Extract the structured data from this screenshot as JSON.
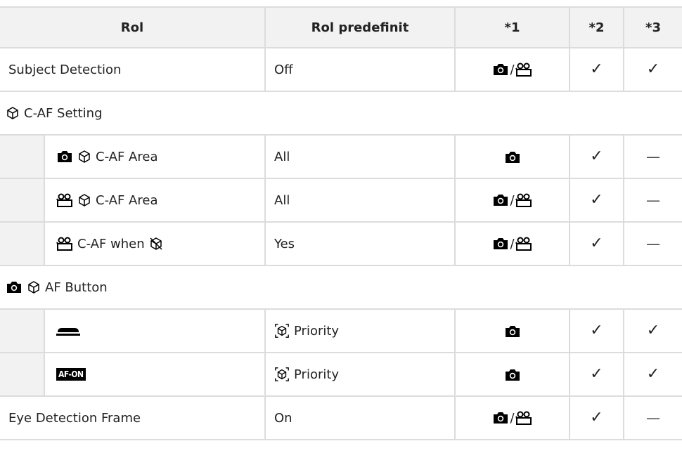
{
  "header": {
    "col1": "Rol",
    "col2": "Rol predefinit",
    "col3": "*1",
    "col4": "*2",
    "col5": "*3"
  },
  "rows": [
    {
      "label": "Subject Detection",
      "value": "Off",
      "c3": "camera-video",
      "c4": "✓",
      "c5": "✓"
    },
    {
      "section": "C-AF Setting"
    },
    {
      "label": "C-AF Area",
      "value": "All",
      "c3": "camera",
      "c4": "✓",
      "c5": "—"
    },
    {
      "label": "C-AF Area",
      "value": "All",
      "c3": "camera-video",
      "c4": "✓",
      "c5": "—"
    },
    {
      "label": "C-AF when",
      "value": "Yes",
      "c3": "camera-video",
      "c4": "✓",
      "c5": "—"
    },
    {
      "section": "AF Button"
    },
    {
      "label": "",
      "value": "Priority",
      "c3": "camera",
      "c4": "✓",
      "c5": "✓"
    },
    {
      "label": "AF-ON",
      "value": "Priority",
      "c3": "camera",
      "c4": "✓",
      "c5": "✓"
    },
    {
      "label": "Eye Detection Frame",
      "value": "On",
      "c3": "camera-video",
      "c4": "✓",
      "c5": "—"
    }
  ],
  "slash": "/"
}
